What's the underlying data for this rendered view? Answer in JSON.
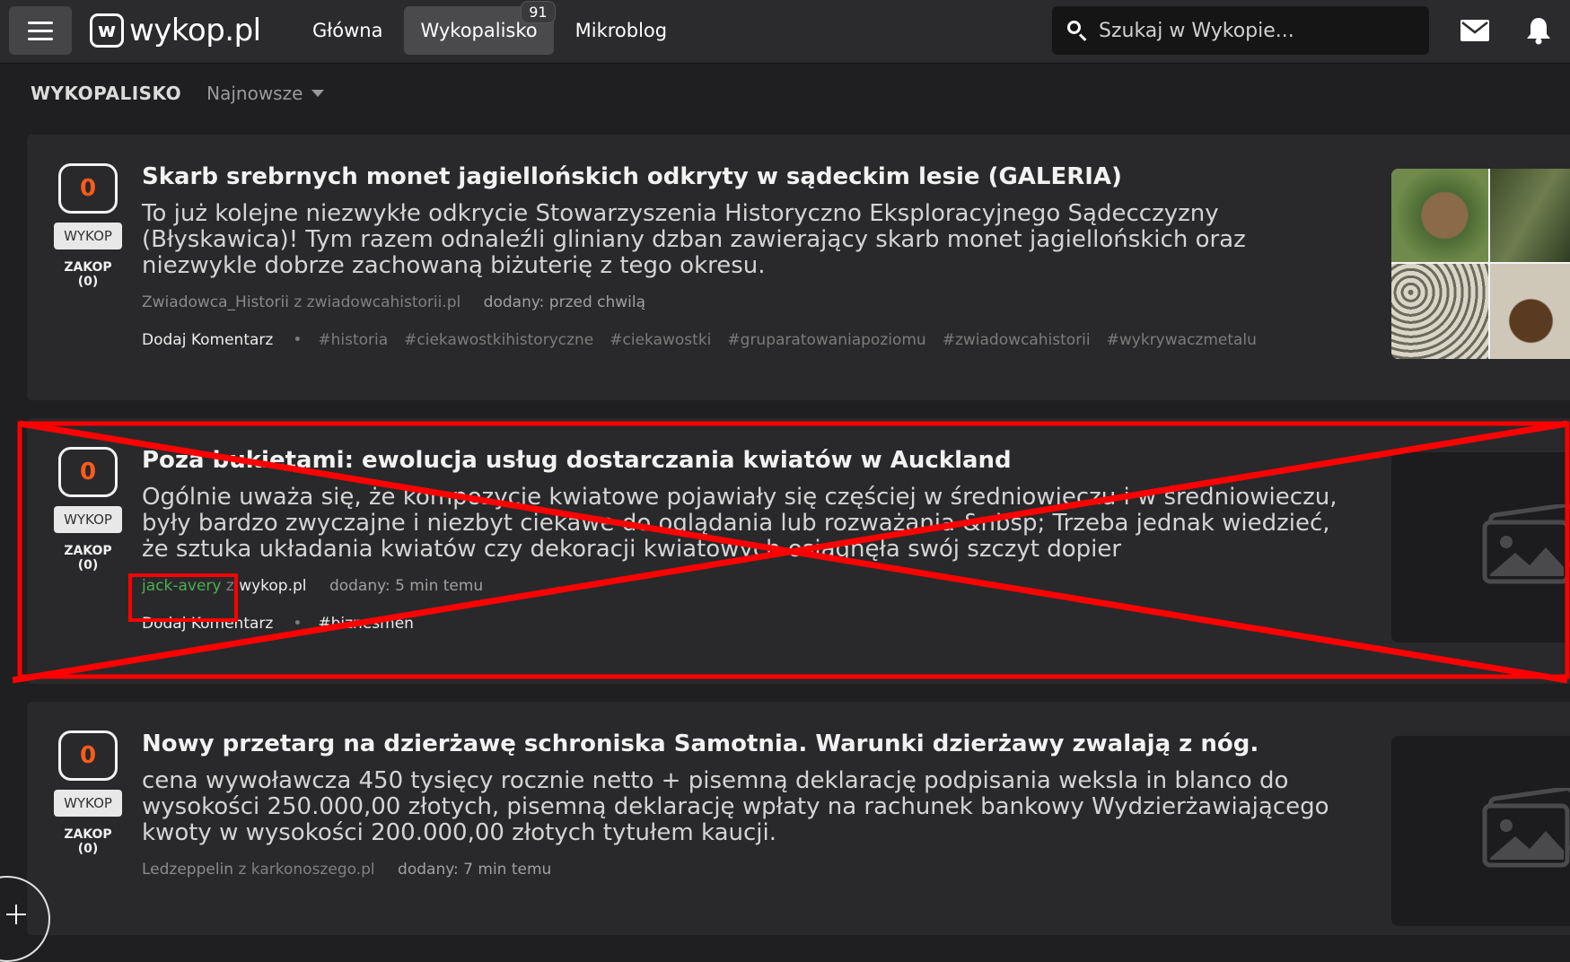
{
  "header": {
    "logo_mark": "w",
    "logo_text": "wykop.pl",
    "nav": [
      {
        "label": "Główna"
      },
      {
        "label": "Wykopalisko",
        "badge": "91"
      },
      {
        "label": "Mikroblog"
      }
    ],
    "search_placeholder": "Szukaj w Wykopie..."
  },
  "page": {
    "title": "WYKOPALISKO",
    "sort_label": "Najnowsze"
  },
  "posts": [
    {
      "votes": "0",
      "vote_label": "WYKOP",
      "bury_label": "ZAKOP (0)",
      "title": "Skarb srebrnych monet jagiellońskich odkryty w sądeckim lesie (GALERIA)",
      "description": "To już kolejne niezwykłe odkrycie Stowarzyszenia Historyczno Eksploracyjnego Sądecczyzny (Błyskawica)! Tym razem odnaleźli gliniany dzban zawierający skarb monet jagiellońskich oraz niezwykle dobrze zachowaną biżuterię z tego okresu.",
      "author": "Zwiadowca_Historii",
      "source": "z zwiadowcahistorii.pl",
      "added": "dodany: przed chwilą",
      "comment_label": "Dodaj Komentarz",
      "tags": [
        "#historia",
        "#ciekawostkihistoryczne",
        "#ciekawostki",
        "#gruparatowaniapoziomu",
        "#zwiadowcahistorii",
        "#wykrywaczmetalu"
      ]
    },
    {
      "votes": "0",
      "vote_label": "WYKOP",
      "bury_label": "ZAKOP (0)",
      "title": "Poza bukietami: ewolucja usług dostarczania kwiatów w Auckland",
      "description": "Ogólnie uważa się, że kompozycje kwiatowe pojawiały się częściej w średniowieczu i w średniowieczu, były bardzo zwyczajne i niezbyt ciekawe do oglądania lub rozważania &nbsp; Trzeba jednak wiedzieć, że sztuka układania kwiatów czy dekoracji kwiatowych osiągnęła swój szczyt dopier",
      "author": "jack-avery",
      "source_prefix": "z",
      "source": "wykop.pl",
      "added": "dodany: 5 min temu",
      "comment_label": "Dodaj Komentarz",
      "tags": [
        "#biznesmen"
      ]
    },
    {
      "votes": "0",
      "vote_label": "WYKOP",
      "bury_label": "ZAKOP (0)",
      "title": "Nowy przetarg na dzierżawę schroniska Samotnia. Warunki dzierżawy zwalają z nóg.",
      "description": "cena wywoławcza 450 tysięcy rocznie netto + pisemną deklarację podpisania weksla in blanco do wysokości 250.000,00 złotych, pisemną deklarację wpłaty na rachunek bankowy Wydzierżawiającego kwoty w wysokości 200.000,00 złotych tytułem kaucji.",
      "author": "Ledzeppelin",
      "source": "z karkonoszego.pl",
      "added": "dodany: 7 min temu"
    }
  ],
  "colors": {
    "accent_vote": "#ff5b1a",
    "annotation_red": "#ff0000",
    "author_green": "#4caf50"
  }
}
